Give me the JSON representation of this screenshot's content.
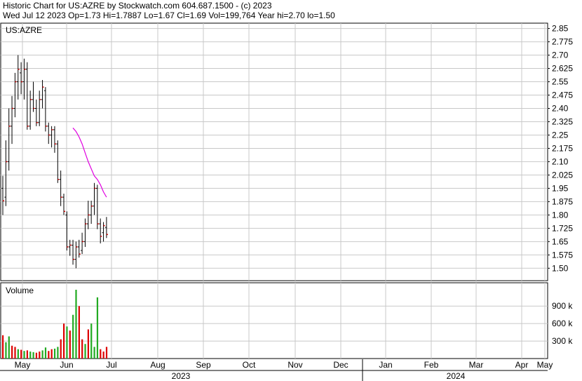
{
  "header": {
    "title": "Historic Chart for US:AZRE by Stockwatch.com 604.687.1500 - (c) 2023",
    "stats": "Wed Jul 12 2023  Op=1.73  Hi=1.7887  Lo=1.67  Cl=1.69  Vol=199,764  Year hi=2.70  lo=1.50"
  },
  "chart_data": [
    {
      "type": "ohlc",
      "symbol": "US:AZRE",
      "ylim": [
        1.43,
        2.88
      ],
      "y_ticks": [
        "2.85",
        "2.775",
        "2.70",
        "2.625",
        "2.55",
        "2.475",
        "2.40",
        "2.325",
        "2.25",
        "2.175",
        "2.10",
        "2.025",
        "1.95",
        "1.875",
        "1.80",
        "1.725",
        "1.65",
        "1.575",
        "1.50"
      ],
      "grid": true,
      "x_months": [
        "May",
        "Jun",
        "Jul",
        "Aug",
        "Sep",
        "Oct",
        "Nov",
        "Dec",
        "Jan",
        "Feb",
        "Mar",
        "Apr",
        "May"
      ],
      "x_years": [
        "2023",
        "2024"
      ],
      "bars": [
        {
          "o": 1.95,
          "h": 2.02,
          "l": 1.8,
          "c": 1.88
        },
        {
          "o": 1.9,
          "h": 2.22,
          "l": 1.85,
          "c": 2.1
        },
        {
          "o": 2.1,
          "h": 2.4,
          "l": 2.05,
          "c": 2.3
        },
        {
          "o": 2.3,
          "h": 2.47,
          "l": 2.2,
          "c": 2.4
        },
        {
          "o": 2.4,
          "h": 2.6,
          "l": 2.35,
          "c": 2.55
        },
        {
          "o": 2.55,
          "h": 2.7,
          "l": 2.45,
          "c": 2.62
        },
        {
          "o": 2.6,
          "h": 2.66,
          "l": 2.48,
          "c": 2.55
        },
        {
          "o": 2.55,
          "h": 2.68,
          "l": 2.45,
          "c": 2.62
        },
        {
          "o": 2.62,
          "h": 2.66,
          "l": 2.28,
          "c": 2.3
        },
        {
          "o": 2.3,
          "h": 2.5,
          "l": 2.28,
          "c": 2.45
        },
        {
          "o": 2.45,
          "h": 2.55,
          "l": 2.38,
          "c": 2.4
        },
        {
          "o": 2.4,
          "h": 2.45,
          "l": 2.3,
          "c": 2.32
        },
        {
          "o": 2.32,
          "h": 2.5,
          "l": 2.3,
          "c": 2.45
        },
        {
          "o": 2.45,
          "h": 2.56,
          "l": 2.4,
          "c": 2.52
        },
        {
          "o": 2.5,
          "h": 2.52,
          "l": 2.27,
          "c": 2.3
        },
        {
          "o": 2.3,
          "h": 2.32,
          "l": 2.2,
          "c": 2.25
        },
        {
          "o": 2.25,
          "h": 2.3,
          "l": 2.18,
          "c": 2.28
        },
        {
          "o": 2.28,
          "h": 2.3,
          "l": 2.15,
          "c": 2.2
        },
        {
          "o": 2.2,
          "h": 2.22,
          "l": 1.98,
          "c": 2.0
        },
        {
          "o": 2.0,
          "h": 2.05,
          "l": 1.85,
          "c": 1.9
        },
        {
          "o": 1.9,
          "h": 1.92,
          "l": 1.8,
          "c": 1.82
        },
        {
          "o": 1.8,
          "h": 1.82,
          "l": 1.6,
          "c": 1.62
        },
        {
          "o": 1.62,
          "h": 1.66,
          "l": 1.57,
          "c": 1.63
        },
        {
          "o": 1.63,
          "h": 1.66,
          "l": 1.52,
          "c": 1.55
        },
        {
          "o": 1.55,
          "h": 1.65,
          "l": 1.5,
          "c": 1.62
        },
        {
          "o": 1.62,
          "h": 1.66,
          "l": 1.56,
          "c": 1.58
        },
        {
          "o": 1.6,
          "h": 1.7,
          "l": 1.58,
          "c": 1.65
        },
        {
          "o": 1.65,
          "h": 1.78,
          "l": 1.62,
          "c": 1.75
        },
        {
          "o": 1.75,
          "h": 1.88,
          "l": 1.72,
          "c": 1.8
        },
        {
          "o": 1.8,
          "h": 1.88,
          "l": 1.75,
          "c": 1.85
        },
        {
          "o": 1.85,
          "h": 1.98,
          "l": 1.8,
          "c": 1.95
        },
        {
          "o": 1.95,
          "h": 1.97,
          "l": 1.72,
          "c": 1.75
        },
        {
          "o": 1.75,
          "h": 1.78,
          "l": 1.64,
          "c": 1.68
        },
        {
          "o": 1.7,
          "h": 1.76,
          "l": 1.65,
          "c": 1.74
        },
        {
          "o": 1.73,
          "h": 1.7887,
          "l": 1.67,
          "c": 1.69
        }
      ],
      "moving_average": [
        2.29,
        2.27,
        2.24,
        2.2,
        2.15,
        2.1,
        2.06,
        2.02,
        2.0,
        1.97,
        1.93,
        1.9
      ],
      "colors": {
        "bar_up": "#000000",
        "bar_down": "#000000",
        "close_tick": "#cc0000",
        "moving_average": "#e000e0",
        "grid": "#c8c8c8"
      }
    },
    {
      "type": "bar",
      "title": "Volume",
      "y_ticks": [
        "900 k",
        "600 k",
        "300 k"
      ],
      "y_tick_values": [
        900000,
        600000,
        300000
      ],
      "ylim": [
        0,
        1300000
      ],
      "volumes": [
        400000,
        280000,
        380000,
        220000,
        200000,
        160000,
        150000,
        130000,
        140000,
        120000,
        110000,
        100000,
        120000,
        140000,
        190000,
        130000,
        160000,
        170000,
        200000,
        330000,
        600000,
        550000,
        480000,
        750000,
        1180000,
        900000,
        330000,
        250000,
        500000,
        600000,
        200000,
        1050000,
        160000,
        120000,
        200000
      ],
      "vol_colors": [
        "r",
        "g",
        "g",
        "r",
        "r",
        "g",
        "r",
        "g",
        "r",
        "g",
        "g",
        "r",
        "r",
        "g",
        "g",
        "r",
        "r",
        "g",
        "g",
        "r",
        "r",
        "g",
        "r",
        "g",
        "g",
        "r",
        "r",
        "g",
        "r",
        "g",
        "g",
        "g",
        "r",
        "r",
        "r"
      ]
    }
  ]
}
